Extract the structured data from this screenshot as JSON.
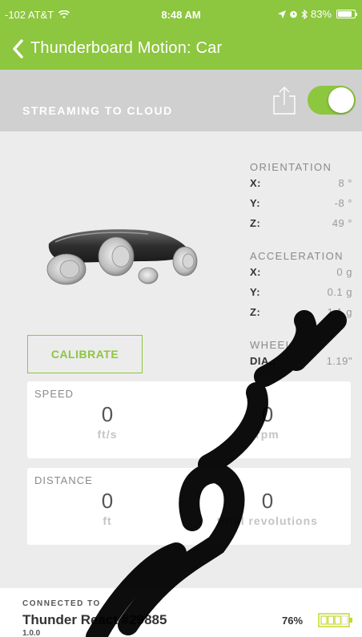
{
  "status_bar": {
    "carrier": "-102 AT&T",
    "time": "8:48 AM",
    "battery": "83%"
  },
  "nav": {
    "back_icon": "chevron-left-icon",
    "title": "Thunderboard Motion: Car"
  },
  "streaming": {
    "label": "STREAMING TO CLOUD",
    "toggle_on": true,
    "share_icon": "share-icon"
  },
  "orientation": {
    "title": "ORIENTATION",
    "rows": [
      {
        "label": "X:",
        "value": "8 °"
      },
      {
        "label": "Y:",
        "value": "-8 °"
      },
      {
        "label": "Z:",
        "value": "49 °"
      }
    ]
  },
  "acceleration": {
    "title": "ACCELERATION",
    "rows": [
      {
        "label": "X:",
        "value": "0 g"
      },
      {
        "label": "Y:",
        "value": "0.1 g"
      },
      {
        "label": "Z:",
        "value": "1.1 g"
      }
    ]
  },
  "wheel": {
    "title": "WHEEL",
    "label": "DIA.:",
    "value": "1.19\""
  },
  "calibrate_label": "CALIBRATE",
  "speed": {
    "title": "SPEED",
    "primary": {
      "value": "0",
      "unit": "ft/s"
    },
    "secondary": {
      "value": "0",
      "unit": "rpm"
    }
  },
  "distance": {
    "title": "DISTANCE",
    "primary": {
      "value": "0",
      "unit": "ft"
    },
    "secondary": {
      "value": "0",
      "unit": "total revolutions"
    }
  },
  "footer": {
    "connected_label": "CONNECTED TO",
    "device_name": "Thunder React #29885",
    "version": "1.0.0",
    "battery_percent": "76%",
    "battery_level": 0.76
  },
  "colors": {
    "accent": "#8dc63f",
    "header_bg": "#8dc63f",
    "stream_bg": "#d0d0d0",
    "main_bg": "#ececec"
  }
}
